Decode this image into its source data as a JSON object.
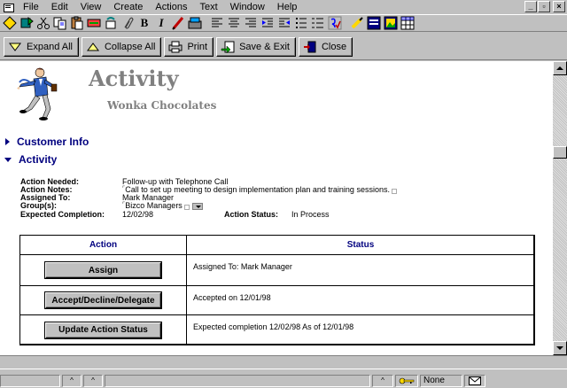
{
  "menubar": {
    "items": [
      {
        "label": "File"
      },
      {
        "label": "Edit"
      },
      {
        "label": "View"
      },
      {
        "label": "Create"
      },
      {
        "label": "Actions"
      },
      {
        "label": "Text"
      },
      {
        "label": "Window"
      },
      {
        "label": "Help"
      }
    ],
    "window_controls": {
      "minimize": "_",
      "restore": "▫",
      "close": "×"
    }
  },
  "iconbar": {
    "items": [
      "smarticon-diamond-icon",
      "smarticon-move-icon",
      "cut-icon",
      "copy-icon",
      "paste-icon",
      "link-icon",
      "refresh-icon",
      "paperclip-icon",
      "bold-icon",
      "italic-icon",
      "permanent-pen-icon",
      "highlight-icon",
      "align-left-icon",
      "align-center-icon",
      "align-right-icon",
      "indent-icon",
      "outdent-icon",
      "bullets-icon",
      "numbers-icon",
      "spellcheck-icon",
      "marker-icon",
      "form-icon",
      "image-icon",
      "table-icon"
    ],
    "bold_glyph": "B",
    "italic_glyph": "I"
  },
  "actionbar": {
    "expand_all": "Expand All",
    "collapse_all": "Collapse All",
    "print": "Print",
    "save_exit": "Save & Exit",
    "close": "Close"
  },
  "document": {
    "title": "Activity",
    "subtitle": "Wonka Chocolates",
    "sections": {
      "customer_info": "Customer Info",
      "activity": "Activity"
    },
    "fields": {
      "action_needed_label": "Action Needed:",
      "action_needed_value": "Follow-up with Telephone Call",
      "action_notes_label": "Action Notes:",
      "action_notes_value": "Call to set up meeting to design implementation plan and training sessions.",
      "assigned_to_label": "Assigned To:",
      "assigned_to_value": "Mark Manager",
      "groups_label": "Group(s):",
      "groups_value": "Bizco Managers",
      "expected_completion_label": "Expected Completion:",
      "expected_completion_value": "12/02/98",
      "action_status_label": "Action Status:",
      "action_status_value": "In Process"
    },
    "table": {
      "header_action": "Action",
      "header_status": "Status",
      "rows": [
        {
          "button": "Assign",
          "status": "Assigned To: Mark Manager"
        },
        {
          "button": "Accept/Decline/Delegate",
          "status": "Accepted on 12/01/98"
        },
        {
          "button": "Update Action Status",
          "status": "Expected completion 12/02/98 As of 12/01/98"
        }
      ]
    }
  },
  "statusbar": {
    "location": "None",
    "carets": [
      "^",
      "^",
      "^"
    ]
  },
  "colors": {
    "chrome": "#c0c0c0",
    "section_blue": "#00007f",
    "title_gray": "#808080"
  }
}
